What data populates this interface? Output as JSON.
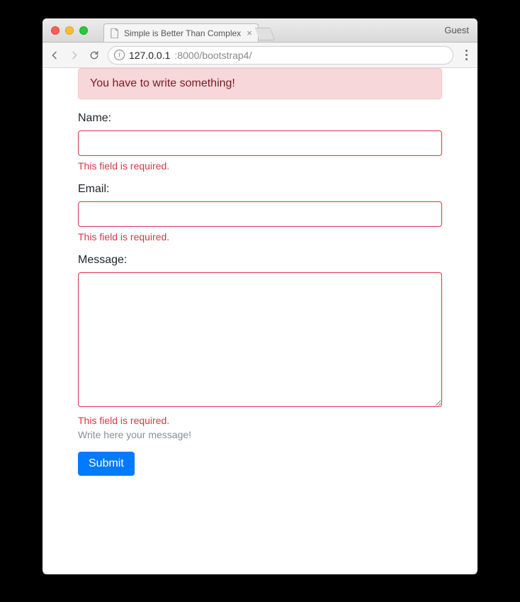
{
  "window": {
    "guest_label": "Guest",
    "tab_title": "Simple is Better Than Complex"
  },
  "toolbar": {
    "url_host": "127.0.0.1",
    "url_port_path": ":8000/bootstrap4/"
  },
  "alert": {
    "message": "You have to write something!"
  },
  "form": {
    "name": {
      "label": "Name:",
      "value": "",
      "error": "This field is required."
    },
    "email": {
      "label": "Email:",
      "value": "",
      "error": "This field is required."
    },
    "message": {
      "label": "Message:",
      "value": "",
      "error": "This field is required.",
      "help": "Write here your message!"
    },
    "submit_label": "Submit"
  }
}
